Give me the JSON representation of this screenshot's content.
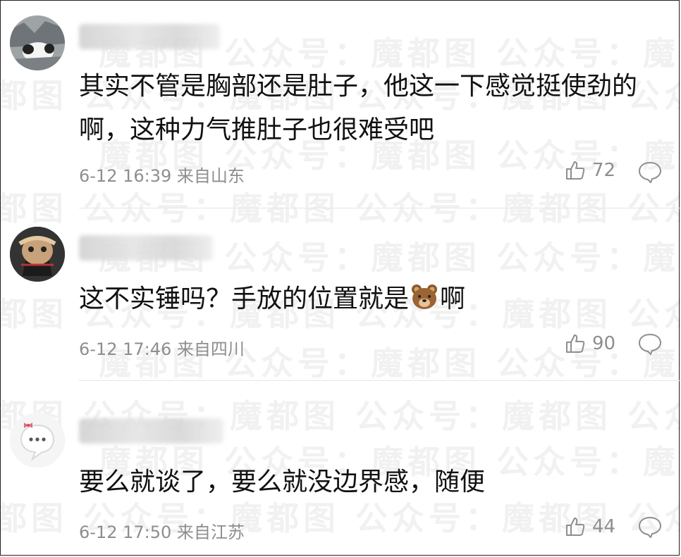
{
  "watermark": "魔都图  公众号：魔都图  公众号：魔都图  公众号：",
  "comments": [
    {
      "avatar": "panda-avatar",
      "text": "其实不管是胸部还是肚子，他这一下感觉挺使劲的啊，这种力气推肚子也很难受吧",
      "meta": "6-12 16:39 来自山东",
      "likes": "72"
    },
    {
      "avatar": "mask-avatar",
      "text_before": "这不实锤吗？手放的位置就是",
      "emoji": "bear-emoji",
      "text_after": "啊",
      "meta": "6-12 17:46 来自四川",
      "likes": "90"
    },
    {
      "avatar": "chat-bubble-avatar",
      "text": "要么就谈了，要么就没边界感，随便",
      "meta": "6-12 17:50 来自江苏",
      "likes": "44"
    }
  ]
}
